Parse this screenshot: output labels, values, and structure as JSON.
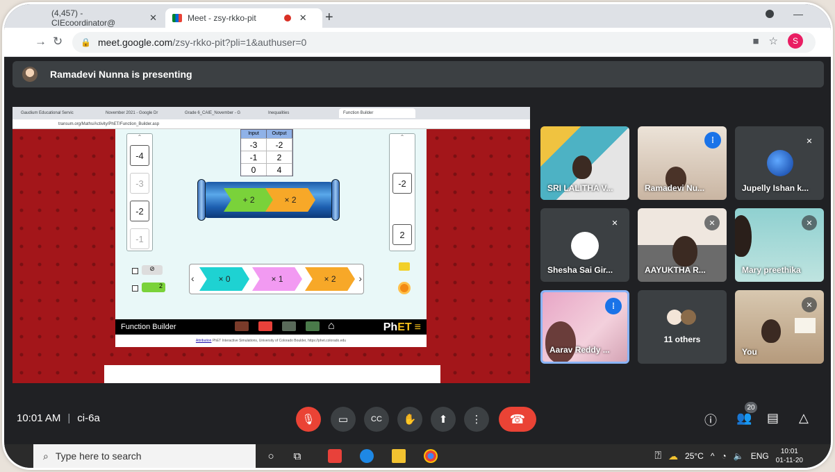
{
  "browser": {
    "tabs": [
      {
        "label": "(4,457) - CIEcoordinator@"
      },
      {
        "label": "Meet - zsy-rkko-pit"
      }
    ],
    "url_host": "meet.google.com",
    "url_path": "/zsy-rkko-pit?pli=1&authuser=0",
    "profile_initial": "S"
  },
  "presenting": {
    "text": "Ramadevi Nunna is presenting"
  },
  "shared_screen": {
    "tabs": [
      {
        "label": "Gaudium Educational Servic"
      },
      {
        "label": "November 2021 - Google Dr"
      },
      {
        "label": "Grade 6_CAIE_November - G"
      },
      {
        "label": "Inequalities"
      },
      {
        "label": "Function Builder"
      }
    ],
    "url": "transum.org/Maths/Activity/PhET/Function_Builder.asp",
    "input_cards": [
      "-4",
      "-3",
      "-2",
      "-1"
    ],
    "table": {
      "headers": [
        "Input",
        "Output"
      ],
      "rows": [
        [
          "-3",
          "-2"
        ],
        [
          "-1",
          "2"
        ],
        [
          "0",
          "4"
        ]
      ]
    },
    "machine_functions": [
      "+ 2",
      "× 2"
    ],
    "output_cards": [
      "-2",
      "2"
    ],
    "carousel_functions": [
      "× 0",
      "× 1",
      "× 2"
    ],
    "checkbox_value": "2",
    "sim_title": "Function Builder",
    "modes": [
      "Patterns",
      "Numbers",
      "Equations",
      "Mystery"
    ],
    "brand_ph": "Ph",
    "brand_et": "ET",
    "attribution_link": "Attribution",
    "attribution_text": "PhET Interactive Simulations, University of Colorado Boulder, https://phet.colorado.edu"
  },
  "participants": [
    {
      "name": "SRI LALITHA V...",
      "state": "none"
    },
    {
      "name": "Ramadevi Nu...",
      "state": "speaking"
    },
    {
      "name": "Jupelly Ishan k...",
      "state": "muted"
    },
    {
      "name": "Shesha Sai Gir...",
      "state": "muted"
    },
    {
      "name": "AAYUKTHA R...",
      "state": "muted"
    },
    {
      "name": "Mary preethika",
      "state": "muted"
    },
    {
      "name": "Aarav Reddy ...",
      "state": "speaking"
    },
    {
      "name": "11 others",
      "state": "none"
    },
    {
      "name": "You",
      "state": "muted"
    }
  ],
  "meeting": {
    "time": "10:01 AM",
    "code": "ci-6a",
    "people_count": "20"
  },
  "taskbar": {
    "search_placeholder": "Type here to search",
    "temperature": "25°C",
    "language": "ENG",
    "clock_time": "10:01",
    "clock_date": "01-11-20"
  },
  "colors": {
    "meet_bg": "#202124",
    "tile_bg": "#3c4043",
    "end_call": "#ea4335",
    "speaking": "#1a73e8"
  }
}
